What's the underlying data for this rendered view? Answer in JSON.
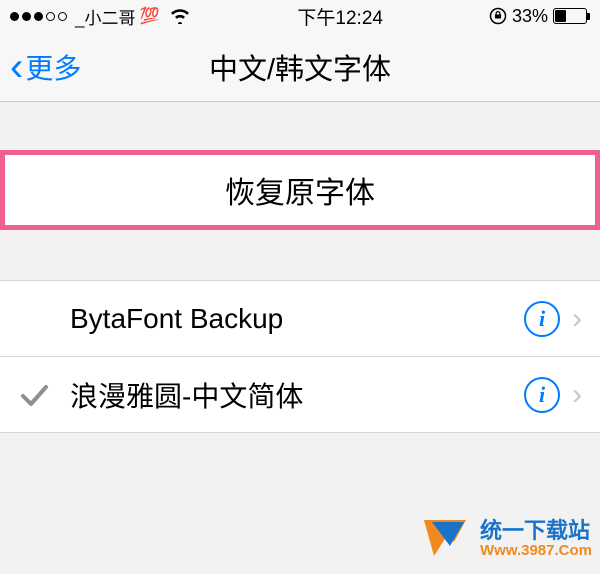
{
  "status": {
    "carrier": "_小二哥",
    "hundred_emoji": "💯",
    "time": "下午12:24",
    "battery_percent": "33%"
  },
  "nav": {
    "back_label": "更多",
    "title": "中文/韩文字体"
  },
  "restore": {
    "label": "恢复原字体"
  },
  "fonts": [
    {
      "name": "BytaFont Backup",
      "selected": false
    },
    {
      "name": "浪漫雅圆-中文简体",
      "selected": true
    }
  ],
  "watermark": {
    "line1": "统一下载站",
    "line2": "Www.3987.Com"
  }
}
